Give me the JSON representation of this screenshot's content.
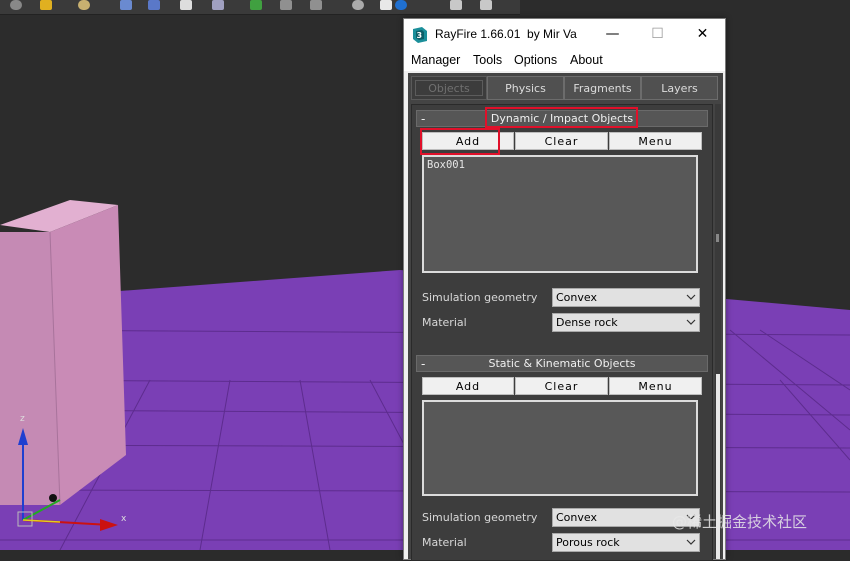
{
  "window": {
    "title": "RayFire 1.66.01  by Mir Va",
    "minimize_glyph": "—",
    "maximize_glyph": "☐",
    "close_glyph": "✕"
  },
  "menu": [
    "Manager",
    "Tools",
    "Options",
    "About"
  ],
  "tabs": [
    {
      "label": "Objects",
      "active": true
    },
    {
      "label": "Physics",
      "active": false
    },
    {
      "label": "Fragments",
      "active": false
    },
    {
      "label": "Layers",
      "active": false
    }
  ],
  "dynamic": {
    "minus": "-",
    "header": "Dynamic / Impact Objects",
    "add": "Add",
    "clear": "Clear",
    "menu": "Menu",
    "items": [
      "Box001"
    ],
    "sim_label": "Simulation geometry",
    "sim_value": "Convex",
    "material_label": "Material",
    "material_value": "Dense rock"
  },
  "static": {
    "minus": "-",
    "header": "Static & Kinematic Objects",
    "add": "Add",
    "clear": "Clear",
    "menu": "Menu",
    "items": [],
    "sim_label": "Simulation geometry",
    "sim_value": "Convex",
    "material_label": "Material",
    "material_value": "Porous rock"
  },
  "gizmo": {
    "z_label": "z",
    "x_label": "x"
  },
  "watermark": "@稀土掘金技术社区",
  "colors": {
    "ground": "#7a3fb5",
    "wall": "#d9a3c6",
    "highlight": "#e0102a"
  }
}
